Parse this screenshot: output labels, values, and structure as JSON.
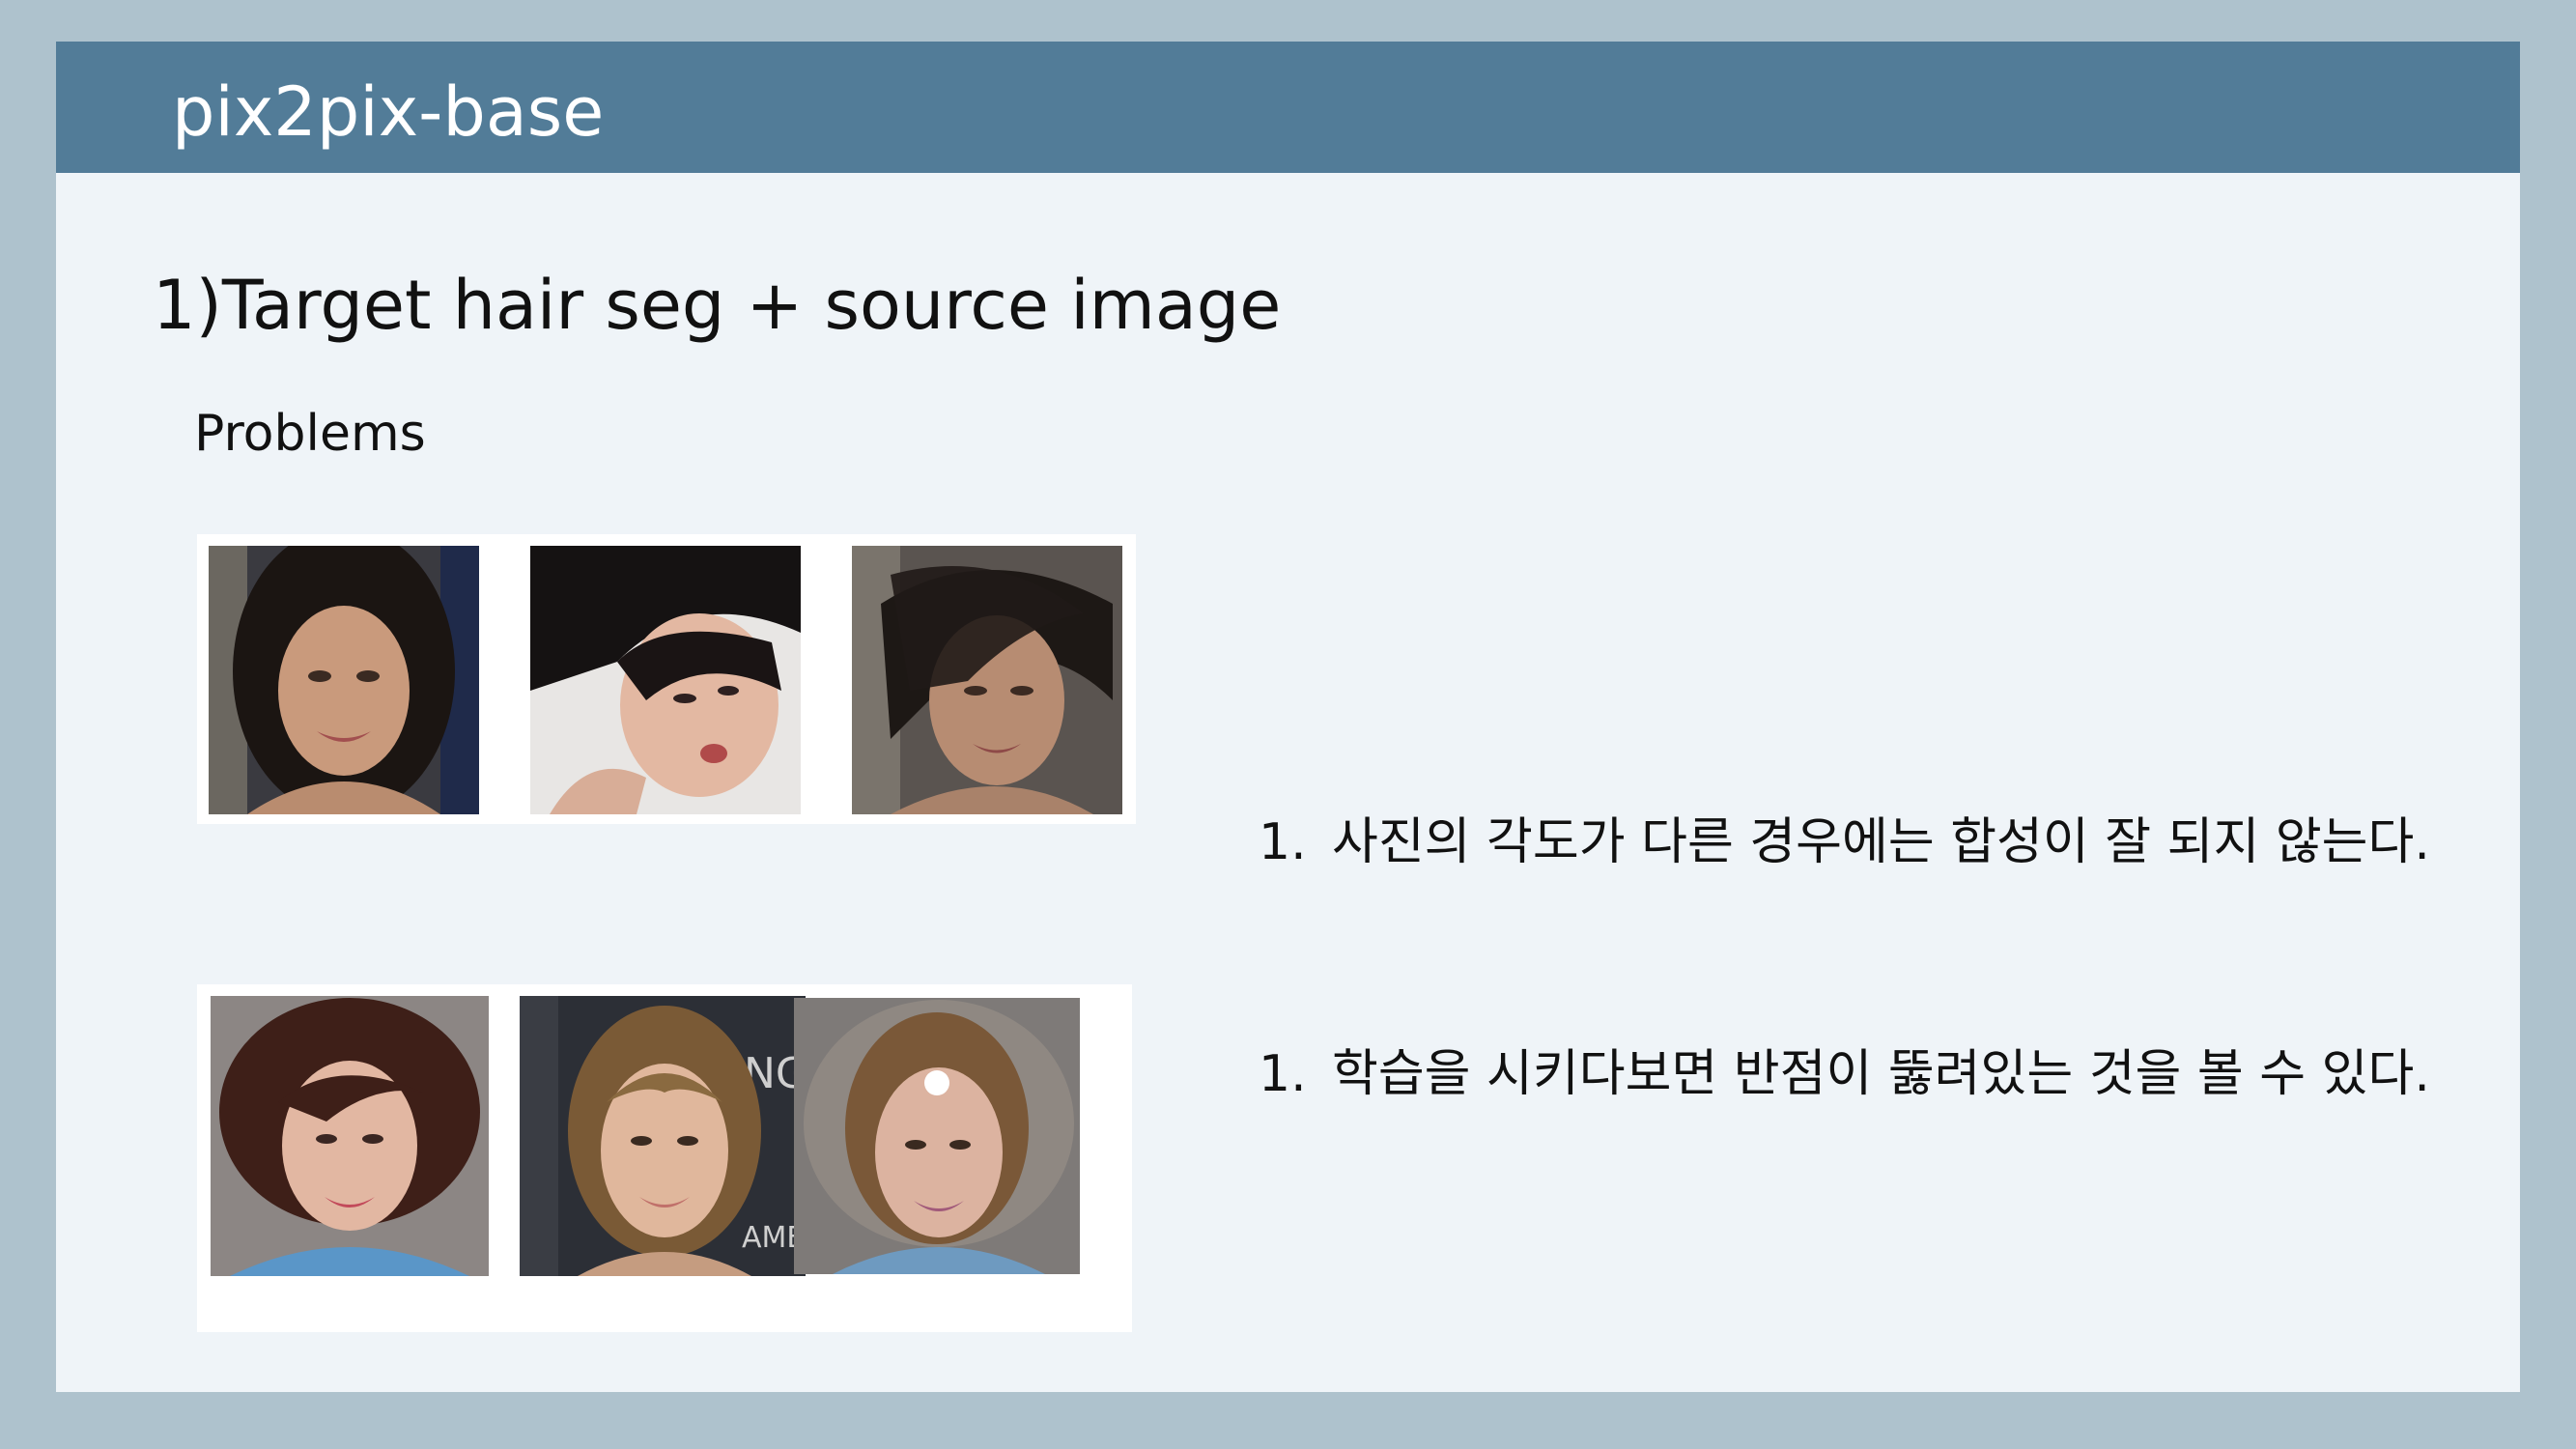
{
  "header": {
    "title": "pix2pix-base"
  },
  "section": {
    "title": "1)Target hair seg + source image",
    "subheading": "Problems"
  },
  "findings": [
    {
      "number": "1.",
      "text": "사진의 각도가 다른 경우에는 합성이 잘 되지 않는다."
    },
    {
      "number": "1.",
      "text": "학습을 시키다보면 반점이 뚫려있는 것을 볼 수 있다."
    }
  ],
  "colors": {
    "header": "#527c98",
    "frame": "#aec2cd",
    "slide": "#eff4f8"
  }
}
